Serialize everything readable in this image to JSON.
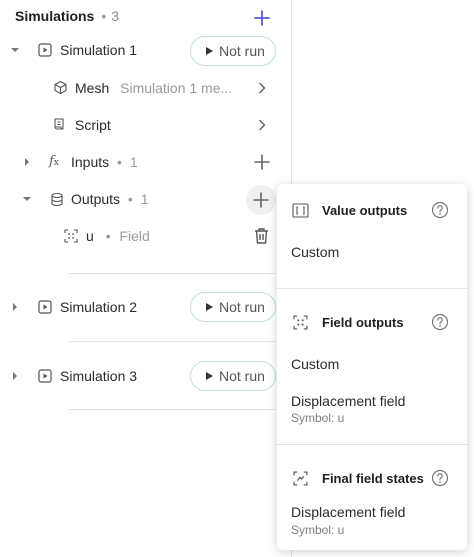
{
  "header": {
    "title": "Simulations",
    "count": "3"
  },
  "sim1": {
    "label": "Simulation 1",
    "status": "Not run",
    "mesh": {
      "label": "Mesh",
      "value": "Simulation 1 me..."
    },
    "script": {
      "label": "Script"
    },
    "inputs": {
      "label": "Inputs",
      "count": "1"
    },
    "outputs": {
      "label": "Outputs",
      "count": "1"
    },
    "output_item": {
      "symbol": "u",
      "type": "Field"
    }
  },
  "sim2": {
    "label": "Simulation 2",
    "status": "Not run"
  },
  "sim3": {
    "label": "Simulation 3",
    "status": "Not run"
  },
  "popup": {
    "value_outputs": {
      "title": "Value outputs",
      "items": [
        "Custom"
      ]
    },
    "field_outputs": {
      "title": "Field outputs",
      "items": [
        "Custom",
        "Displacement field"
      ],
      "displacement_symbol": "Symbol: u"
    },
    "final_field_states": {
      "title": "Final field states",
      "item": "Displacement field",
      "symbol": "Symbol: u"
    }
  },
  "colors": {
    "accent": "#5b5bd6",
    "badge_border": "#bfe3dd",
    "divider": "#e3e3e6"
  },
  "icons": [
    "plus-icon",
    "chevron-down-icon",
    "chevron-right-icon",
    "play-square-icon",
    "cube-icon",
    "scroll-icon",
    "function-icon",
    "database-icon",
    "field-icon",
    "trash-icon",
    "help-icon",
    "bracket-icon",
    "play-icon"
  ]
}
